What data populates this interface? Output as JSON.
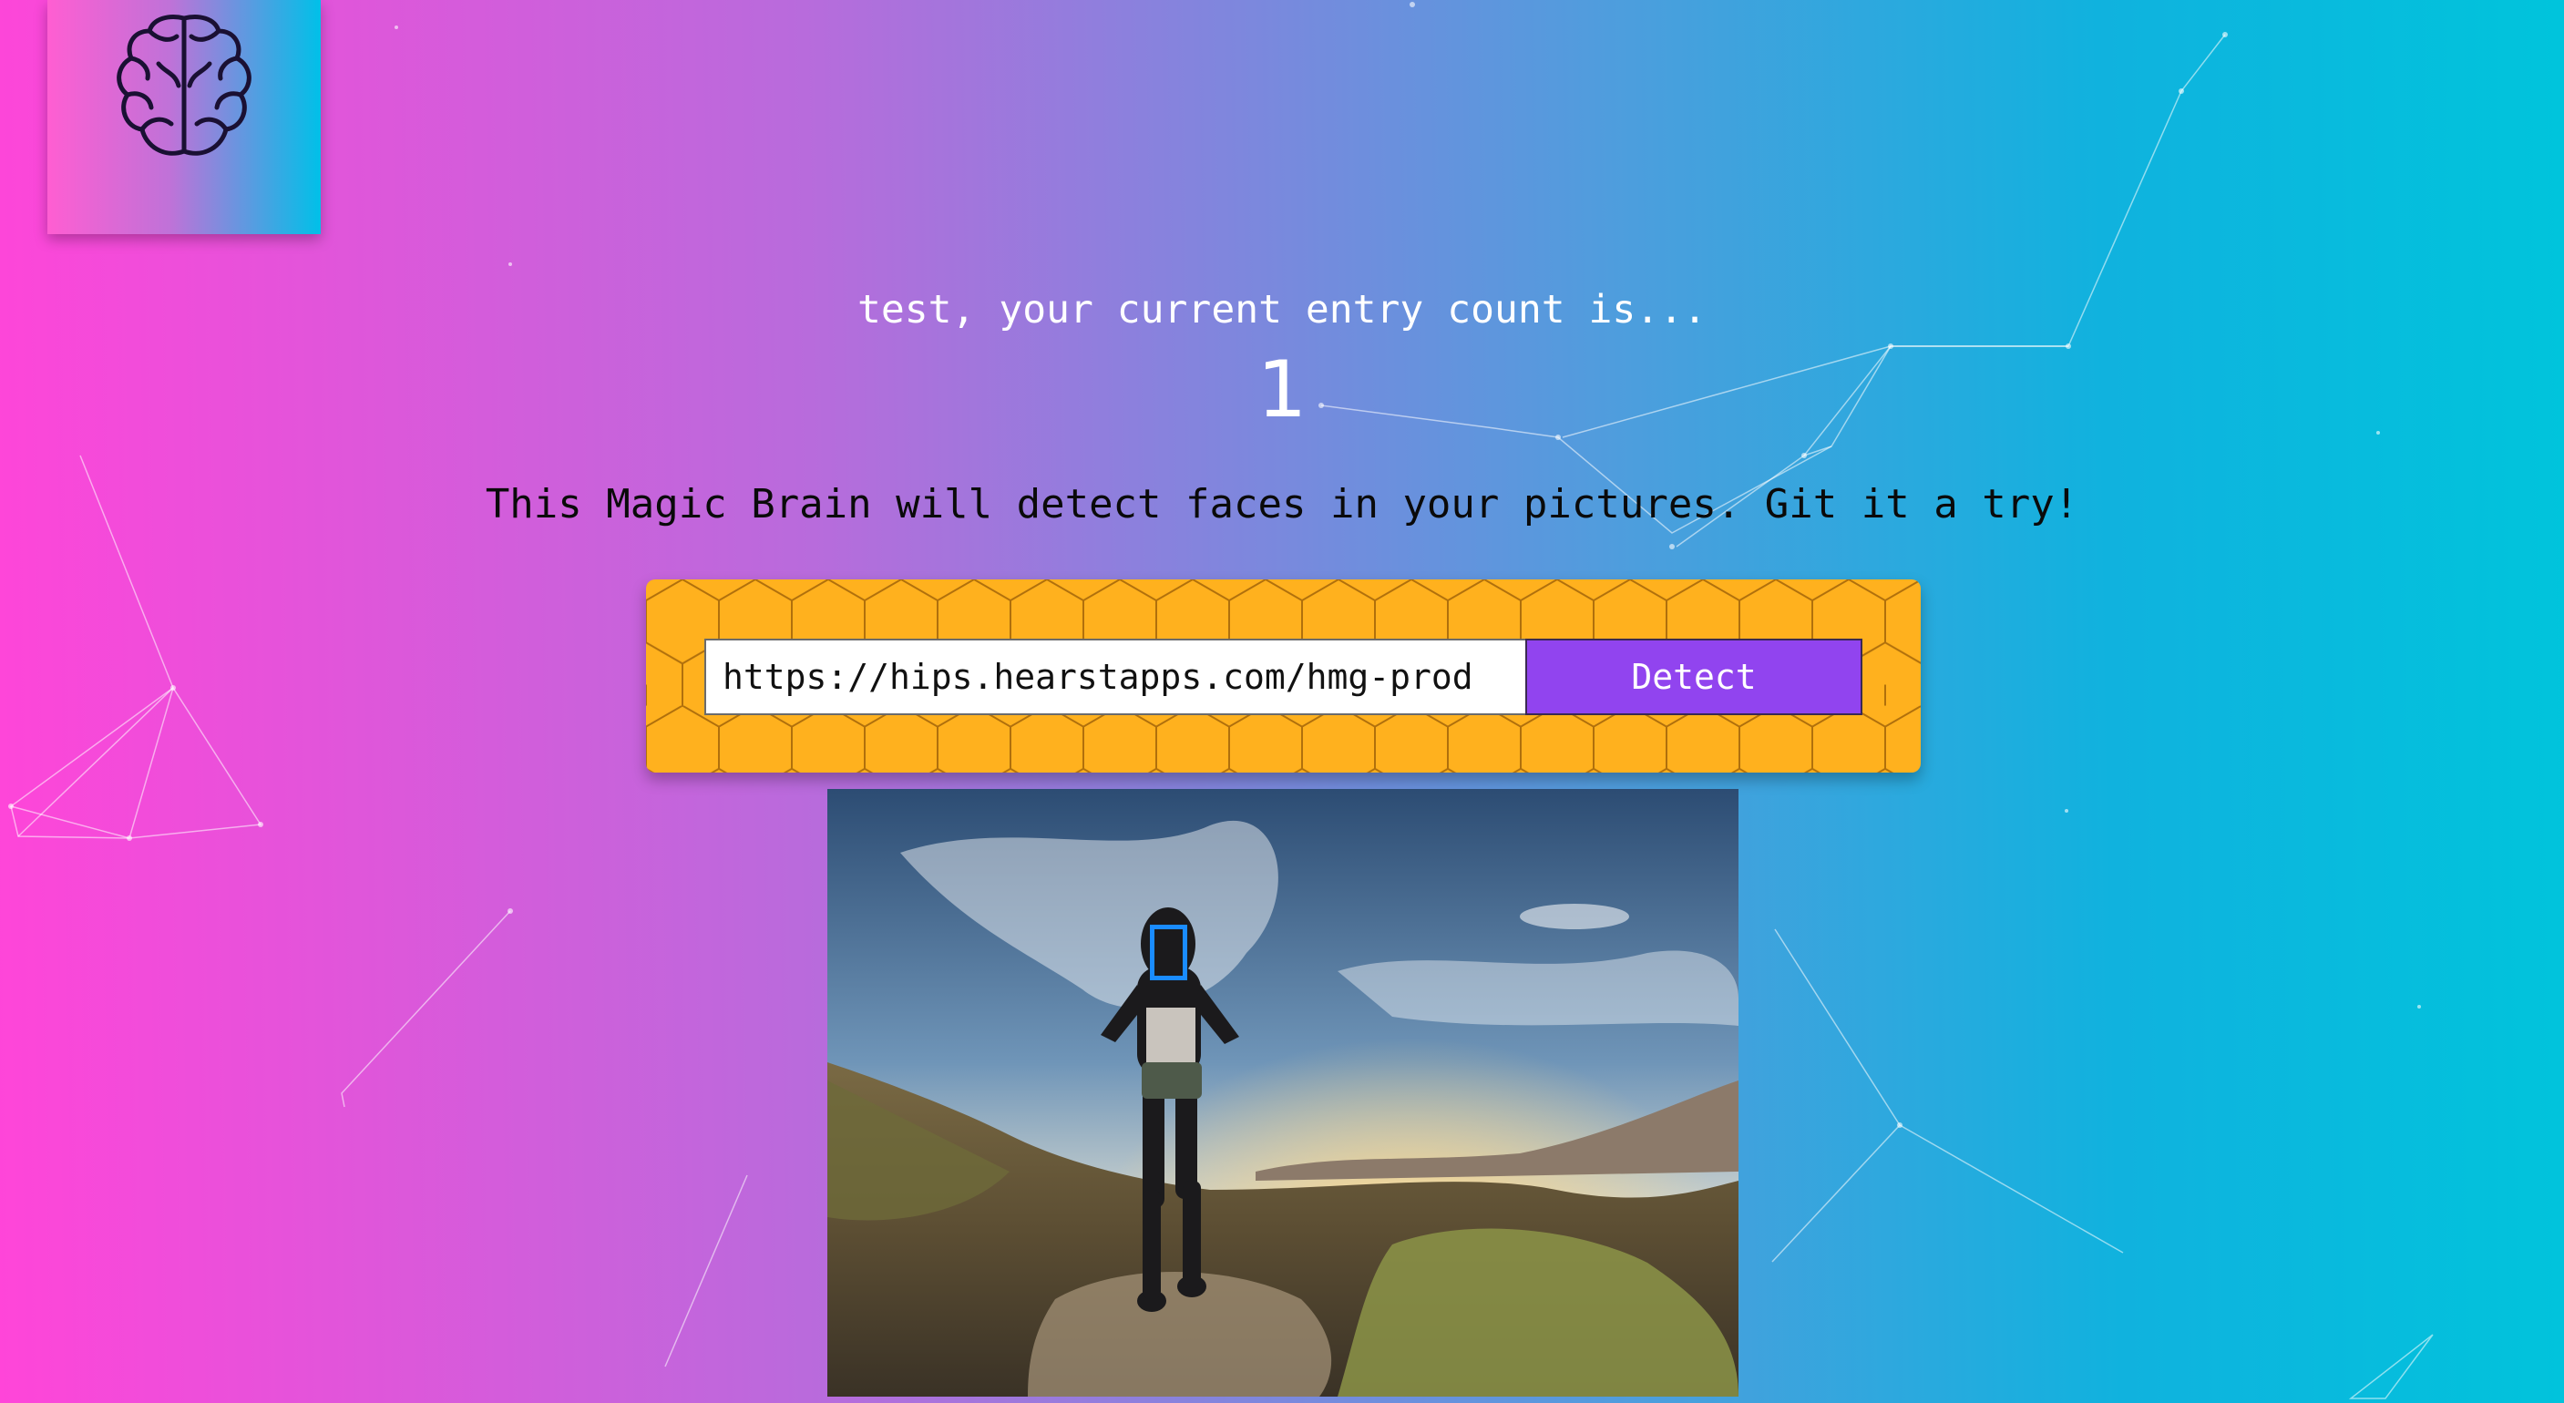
{
  "app": {
    "logo_icon": "brain-icon"
  },
  "rank": {
    "greeting": "test, your current entry count is...",
    "count": "1"
  },
  "intro": {
    "text": "This Magic Brain will detect faces in your pictures. Git it a try!"
  },
  "form": {
    "url_value": "https://hips.hearstapps.com/hmg-prod",
    "button_label": "Detect"
  },
  "result": {
    "image_subject": "hiker walking on desert trail at sunset",
    "face_count": 1
  },
  "colors": {
    "accent": "#9144ef",
    "panel": "#ffb11e",
    "face_box": "#1a8cff"
  }
}
